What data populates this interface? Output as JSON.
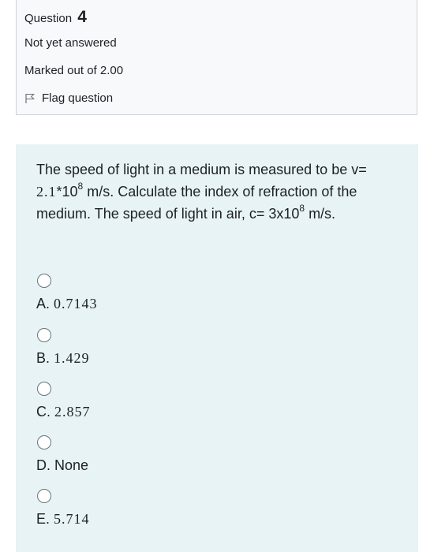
{
  "info": {
    "question_word": "Question",
    "question_number": "4",
    "state": "Not yet answered",
    "grade": "Marked out of 2.00",
    "flag_label": "Flag question",
    "flag_icon": "flag-icon"
  },
  "question": {
    "text_part1": "The speed of light in a medium is measured to be v= ",
    "v_value": "2.1",
    "v_rest": "*10",
    "v_exp": "8",
    "text_part2": " m/s. Calculate the index of refraction of the medium. The speed of light in air, c= 3x10",
    "c_exp": "8",
    "text_part3": " m/s."
  },
  "options": [
    {
      "letter": "A. ",
      "value": "0.7143"
    },
    {
      "letter": "B. ",
      "value": "1.429"
    },
    {
      "letter": "C. ",
      "value": "2.857"
    },
    {
      "letter": "D. ",
      "value": "None"
    },
    {
      "letter": "E. ",
      "value": "5.714"
    }
  ]
}
